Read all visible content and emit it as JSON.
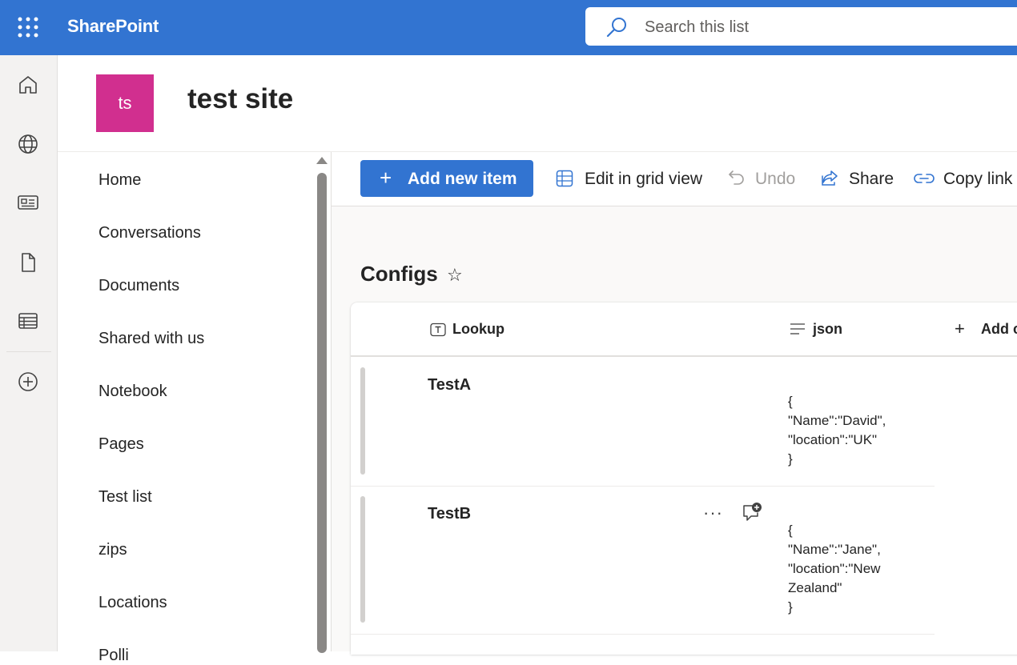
{
  "suite": {
    "app_name": "SharePoint",
    "search_placeholder": "Search this list",
    "accent": "#3274d1"
  },
  "appbar": {
    "icons": [
      "home-icon",
      "globe-icon",
      "news-icon",
      "file-icon",
      "lists-icon",
      "add-circle-icon"
    ]
  },
  "site": {
    "logo_initials": "ts",
    "logo_color": "#d12f8f",
    "title": "test site"
  },
  "leftnav": {
    "items": [
      "Home",
      "Conversations",
      "Documents",
      "Shared with us",
      "Notebook",
      "Pages",
      "Test list",
      "zips",
      "Locations",
      "Polli"
    ]
  },
  "commandbar": {
    "add_new_item": "Add new item",
    "edit_grid": "Edit in grid view",
    "undo": "Undo",
    "share": "Share",
    "copy_link": "Copy link"
  },
  "list": {
    "title": "Configs",
    "columns": {
      "lookup": "Lookup",
      "json": "json",
      "add_column": "Add c"
    },
    "rows": [
      {
        "title": "TestA",
        "json": "{\n\"Name\":\"David\",\n\"location\":\"UK\"\n}"
      },
      {
        "title": "TestB",
        "json": "{\n\"Name\":\"Jane\",\n\"location\":\"New\nZealand\"\n}"
      }
    ]
  }
}
